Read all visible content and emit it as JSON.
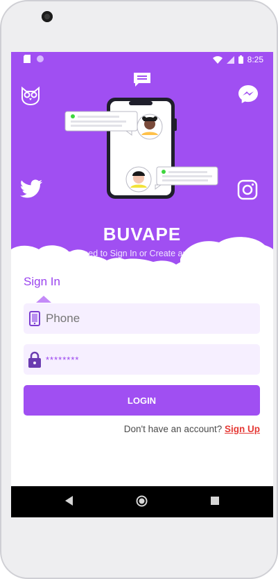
{
  "status_bar": {
    "time": "8:25"
  },
  "hero": {
    "app_name": "BUVAPE",
    "subtitle": "You need to Sign In or Create an account.",
    "icons": [
      "chat-icon",
      "owl-icon",
      "messenger-icon",
      "twitter-icon",
      "instagram-icon"
    ]
  },
  "auth": {
    "tab_label": "Sign In",
    "phone_placeholder": "Phone",
    "password_value": "********",
    "login_label": "LOGIN",
    "signup_prompt": "Don't have an account?",
    "signup_link": "Sign Up"
  },
  "colors": {
    "primary": "#a04ff2",
    "field_bg": "#f6efff",
    "link": "#e53935"
  },
  "nav": {
    "buttons": [
      "back",
      "home",
      "recents"
    ]
  }
}
